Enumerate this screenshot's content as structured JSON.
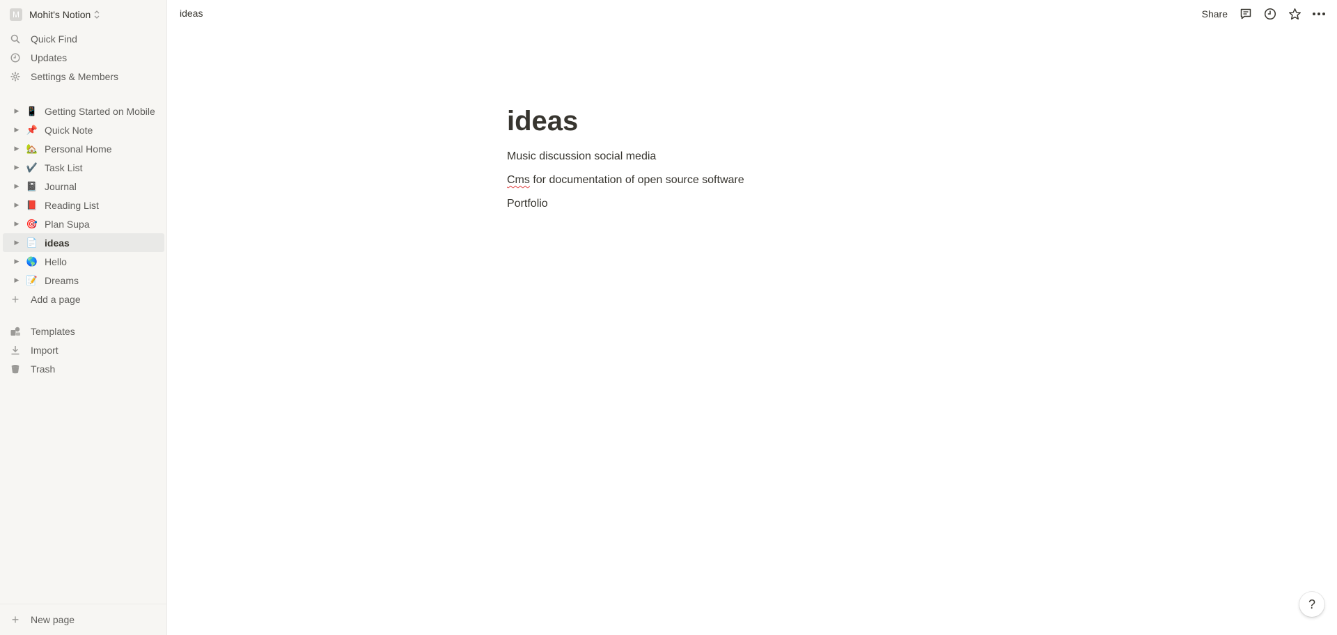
{
  "sidebar": {
    "workspace": {
      "avatar_letter": "M",
      "name": "Mohit's Notion"
    },
    "nav": [
      {
        "label": "Quick Find",
        "icon": "search-icon"
      },
      {
        "label": "Updates",
        "icon": "clock-icon"
      },
      {
        "label": "Settings & Members",
        "icon": "gear-icon"
      }
    ],
    "pages": [
      {
        "label": "Getting Started on Mobile",
        "emoji": "📱"
      },
      {
        "label": "Quick Note",
        "emoji": "📌"
      },
      {
        "label": "Personal Home",
        "emoji": "🏡"
      },
      {
        "label": "Task List",
        "emoji": "✔️"
      },
      {
        "label": "Journal",
        "emoji": "📓"
      },
      {
        "label": "Reading List",
        "emoji": "📕"
      },
      {
        "label": "Plan Supa",
        "emoji": "🎯"
      },
      {
        "label": "ideas",
        "emoji": "📄",
        "active": true
      },
      {
        "label": "Hello",
        "emoji": "🌎"
      },
      {
        "label": "Dreams",
        "emoji": "📝"
      }
    ],
    "add_page": "Add a page",
    "footer_items": [
      {
        "label": "Templates",
        "icon": "templates-icon"
      },
      {
        "label": "Import",
        "icon": "download-icon"
      },
      {
        "label": "Trash",
        "icon": "trash-icon"
      }
    ],
    "new_page": "New page"
  },
  "topbar": {
    "breadcrumb": "ideas",
    "share": "Share",
    "icons": [
      "comment-icon",
      "clock-icon",
      "star-icon",
      "more-icon"
    ]
  },
  "page": {
    "title": "ideas",
    "blocks": [
      {
        "text": "Music discussion social media"
      },
      {
        "misspelled": "Cms",
        "rest": " for documentation of open source software"
      },
      {
        "text": "Portfolio"
      }
    ]
  },
  "help": "?",
  "colors": {
    "sidebar_bg": "#f7f6f3",
    "active_bg": "#e9e9e7",
    "text": "#37352f",
    "muted": "#9b9a97",
    "spell_error": "#e03e3e"
  }
}
